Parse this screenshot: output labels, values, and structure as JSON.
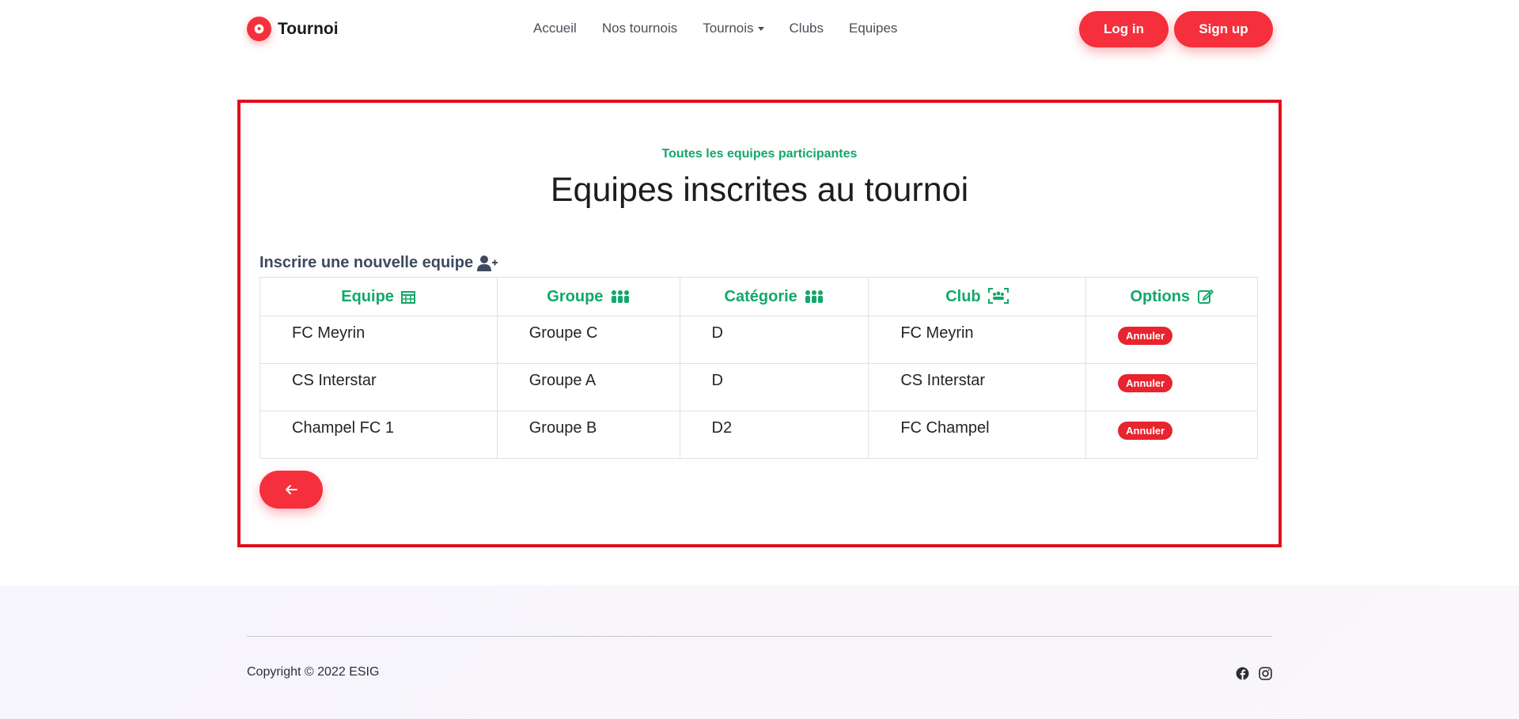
{
  "brand": {
    "name": "Tournoi",
    "accent": "#f52f3b"
  },
  "nav": {
    "items": [
      {
        "label": "Accueil"
      },
      {
        "label": "Nos tournois"
      },
      {
        "label": "Tournois",
        "has_dropdown": true
      },
      {
        "label": "Clubs"
      },
      {
        "label": "Equipes"
      }
    ]
  },
  "auth": {
    "login": "Log in",
    "signup": "Sign up"
  },
  "main": {
    "subtitle": "Toutes les equipes participantes",
    "title": "Equipes inscrites au tournoi",
    "register_link": "Inscrire une nouvelle equipe",
    "table": {
      "headers": [
        "Equipe",
        "Groupe",
        "Catégorie",
        "Club",
        "Options"
      ],
      "rows": [
        {
          "equipe": "FC Meyrin",
          "groupe": "Groupe C",
          "categorie": "D",
          "club": "FC Meyrin",
          "action": "Annuler"
        },
        {
          "equipe": "CS Interstar",
          "groupe": "Groupe A",
          "categorie": "D",
          "club": "CS Interstar",
          "action": "Annuler"
        },
        {
          "equipe": "Champel FC 1",
          "groupe": "Groupe B",
          "categorie": "D2",
          "club": "FC Champel",
          "action": "Annuler"
        }
      ]
    },
    "highlight_color": "#e0101d",
    "header_color": "#12a86b"
  },
  "footer": {
    "copyright": "Copyright © 2022 ESIG",
    "social_icons": [
      "facebook-icon",
      "instagram-icon"
    ]
  }
}
